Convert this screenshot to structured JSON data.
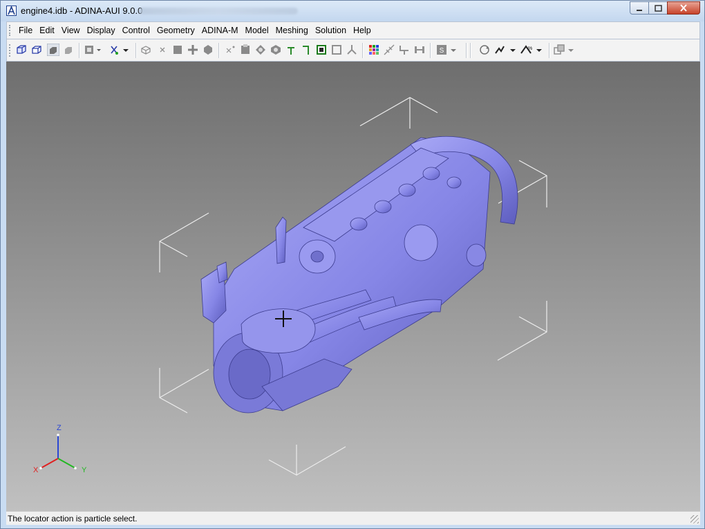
{
  "window": {
    "title": "engine4.idb - ADINA-AUI  9.0.0"
  },
  "menu": {
    "items": [
      {
        "id": "file",
        "label": "File"
      },
      {
        "id": "edit",
        "label": "Edit"
      },
      {
        "id": "view",
        "label": "View"
      },
      {
        "id": "display",
        "label": "Display"
      },
      {
        "id": "control",
        "label": "Control"
      },
      {
        "id": "geometry",
        "label": "Geometry"
      },
      {
        "id": "adina-m",
        "label": "ADINA-M"
      },
      {
        "id": "model",
        "label": "Model"
      },
      {
        "id": "meshing",
        "label": "Meshing"
      },
      {
        "id": "solution",
        "label": "Solution"
      },
      {
        "id": "help",
        "label": "Help"
      }
    ]
  },
  "triad": {
    "z_label": "Z",
    "x_label": "X",
    "y_label": "Y",
    "colors": {
      "z": "#2a46d4",
      "x": "#e02020",
      "y": "#22b822"
    }
  },
  "model": {
    "name_icon": "engine-model",
    "shade_color": "#8f8fee"
  },
  "status": {
    "text": "The locator action is particle select."
  }
}
